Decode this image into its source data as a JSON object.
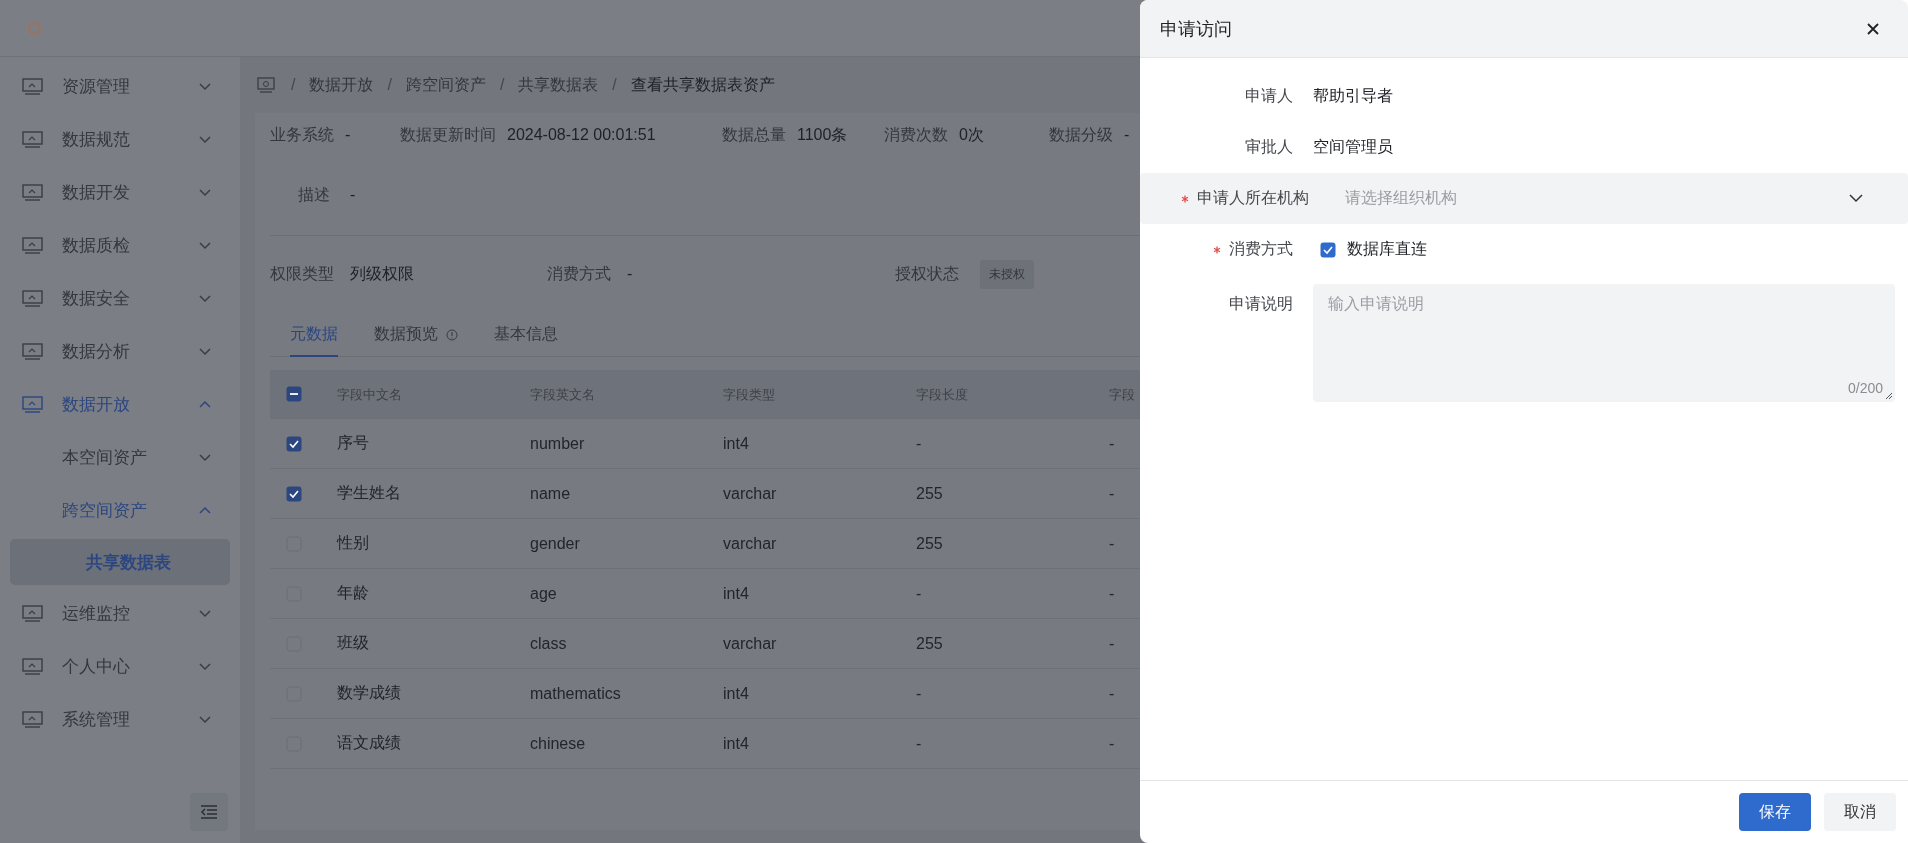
{
  "sidebar": {
    "items": [
      {
        "label": "资源管理",
        "expanded": false,
        "selected": false
      },
      {
        "label": "数据规范",
        "expanded": false,
        "selected": false
      },
      {
        "label": "数据开发",
        "expanded": false,
        "selected": false
      },
      {
        "label": "数据质检",
        "expanded": false,
        "selected": false
      },
      {
        "label": "数据安全",
        "expanded": false,
        "selected": false
      },
      {
        "label": "数据分析",
        "expanded": false,
        "selected": false
      },
      {
        "label": "数据开放",
        "expanded": true,
        "selected": false,
        "children": [
          {
            "label": "本空间资产",
            "expanded": false,
            "selected": false
          },
          {
            "label": "跨空间资产",
            "expanded": true,
            "selected": false,
            "children": [
              {
                "label": "共享数据表",
                "selected": true
              }
            ]
          }
        ]
      },
      {
        "label": "运维监控",
        "expanded": false,
        "selected": false
      },
      {
        "label": "个人中心",
        "expanded": false,
        "selected": false
      },
      {
        "label": "系统管理",
        "expanded": false,
        "selected": false
      }
    ]
  },
  "breadcrumb": {
    "separator": "/",
    "items": [
      "数据开放",
      "跨空间资产",
      "共享数据表",
      "查看共享数据表资产"
    ]
  },
  "summary": {
    "fields": [
      {
        "label": "业务系统",
        "value": "-"
      },
      {
        "label": "数据更新时间",
        "value": "2024-08-12 00:01:51"
      },
      {
        "label": "数据总量",
        "value": "1100条"
      },
      {
        "label": "消费次数",
        "value": "0次"
      },
      {
        "label": "数据分级",
        "value": "-"
      }
    ],
    "description": {
      "label": "描述",
      "value": "-"
    }
  },
  "permissions": [
    {
      "label": "权限类型",
      "value": "列级权限",
      "kind": "text"
    },
    {
      "label": "消费方式",
      "value": "-",
      "kind": "text"
    },
    {
      "label": "授权状态",
      "value": "未授权",
      "kind": "tag"
    }
  ],
  "tabs": [
    {
      "label": "元数据",
      "selected": true,
      "info": false
    },
    {
      "label": "数据预览",
      "selected": false,
      "info": true
    },
    {
      "label": "基本信息",
      "selected": false,
      "info": false
    }
  ],
  "table": {
    "select_all_indeterminate": true,
    "columns": [
      "字段中文名",
      "字段英文名",
      "字段类型",
      "字段长度",
      "字段"
    ],
    "rows": [
      {
        "checked": true,
        "cells": [
          "序号",
          "number",
          "int4",
          "-",
          "-"
        ]
      },
      {
        "checked": true,
        "cells": [
          "学生姓名",
          "name",
          "varchar",
          "255",
          "-"
        ]
      },
      {
        "checked": false,
        "cells": [
          "性别",
          "gender",
          "varchar",
          "255",
          "-"
        ]
      },
      {
        "checked": false,
        "cells": [
          "年龄",
          "age",
          "int4",
          "-",
          "-"
        ]
      },
      {
        "checked": false,
        "cells": [
          "班级",
          "class",
          "varchar",
          "255",
          "-"
        ]
      },
      {
        "checked": false,
        "cells": [
          "数学成绩",
          "mathematics",
          "int4",
          "-",
          "-"
        ]
      },
      {
        "checked": false,
        "cells": [
          "语文成绩",
          "chinese",
          "int4",
          "-",
          "-"
        ]
      }
    ]
  },
  "drawer": {
    "title": "申请访问",
    "fields": [
      {
        "kind": "text",
        "label": "申请人",
        "value": "帮助引导者",
        "required": false
      },
      {
        "kind": "text",
        "label": "审批人",
        "value": "空间管理员",
        "required": false
      },
      {
        "kind": "select",
        "label": "申请人所在机构",
        "placeholder": "请选择组织机构",
        "required": true
      },
      {
        "kind": "checkbox",
        "label": "消费方式",
        "option": "数据库直连",
        "checked": true,
        "required": true
      },
      {
        "kind": "textarea",
        "label": "申请说明",
        "placeholder": "输入申请说明",
        "counter": "0/200",
        "required": false
      }
    ],
    "buttons": [
      {
        "label": "保存",
        "kind": "primary"
      },
      {
        "label": "取消",
        "kind": "default"
      }
    ]
  }
}
